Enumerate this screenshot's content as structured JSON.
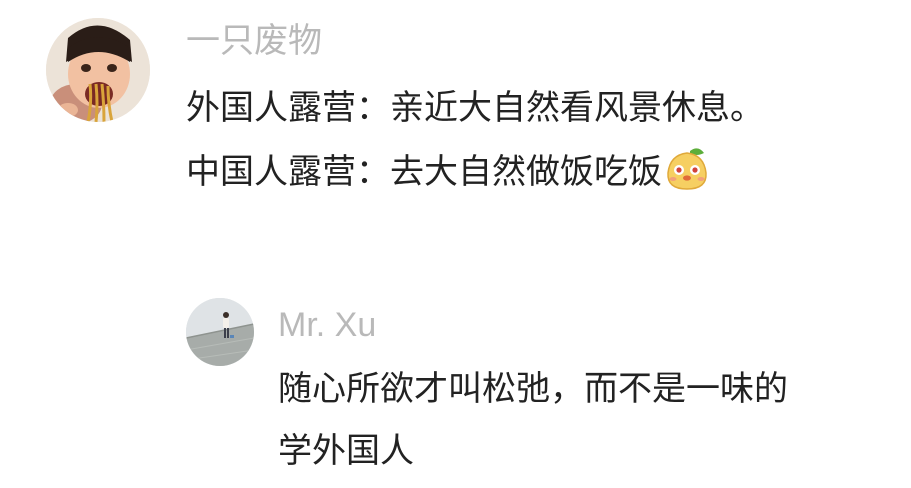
{
  "comment": {
    "author": "一只废物",
    "avatar_icon": "child-eating-noodles-avatar",
    "lines": [
      "外国人露营：亲近大自然看风景休息。",
      "中国人露营：去大自然做饭吃饭"
    ],
    "trailing_emoji": "smiling-pear-emoji"
  },
  "reply": {
    "author": "Mr. Xu",
    "avatar_icon": "person-on-wall-avatar",
    "lines": [
      "随心所欲才叫松弛，而不是一味的",
      "学外国人"
    ]
  },
  "colors": {
    "author_gray": "#b9b9b9",
    "text": "#222222",
    "background": "#ffffff"
  }
}
